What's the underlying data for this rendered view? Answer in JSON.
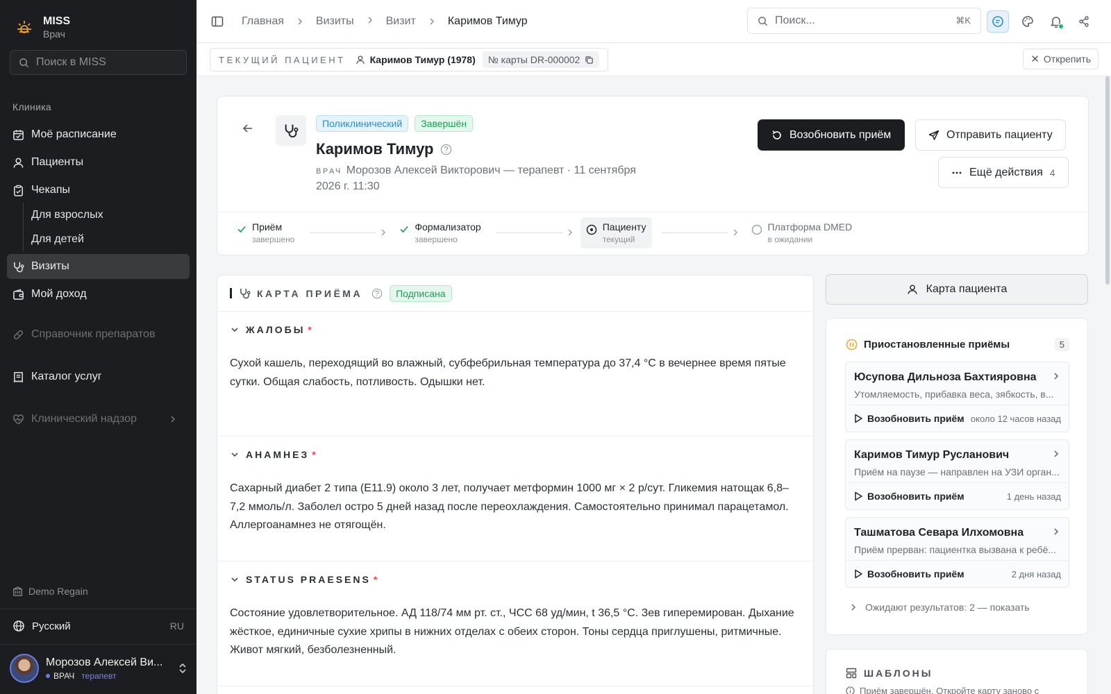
{
  "sidebar": {
    "app_name": "MISS",
    "app_role": "Врач",
    "search_placeholder": "Поиск в MISS",
    "section_label": "Клиника",
    "items": {
      "schedule": "Моё расписание",
      "patients": "Пациенты",
      "checkups": "Чекапы",
      "checkups_adults": "Для взрослых",
      "checkups_children": "Для детей",
      "visits": "Визиты",
      "income": "Мой доход",
      "drugs": "Справочник препаратов",
      "services": "Каталог услуг",
      "supervision": "Клинический надзор"
    },
    "region": "Demo Regain",
    "language": "Русский",
    "language_code": "RU",
    "user_name": "Морозов Алексей Ви...",
    "user_role": "ВРАЧ",
    "user_specialty": "терапевт"
  },
  "topbar": {
    "breadcrumbs": [
      "Главная",
      "Визиты",
      "Визит",
      "Каримов Тимур"
    ],
    "search_placeholder": "Поиск...",
    "search_shortcut": "⌘K"
  },
  "patient_strip": {
    "label": "ТЕКУЩИЙ ПАЦИЕНТ",
    "patient": "Каримов Тимур (1978)",
    "card_number": "№ карты DR-000002",
    "unpin": "Открепить"
  },
  "visit": {
    "type_badge": "Поликлинический",
    "status_badge": "Завершён",
    "patient_name": "Каримов Тимур",
    "doctor_prefix": "ВРАЧ",
    "doctor_line": "Морозов Алексей Викторович — терапевт · 11 сентября 2026 г. 11:30",
    "resume_button": "Возобновить приём",
    "send_button": "Отправить пациенту",
    "more_button": "Ещё действия",
    "more_count": "4",
    "steps": [
      {
        "title": "Приём",
        "status": "завершено"
      },
      {
        "title": "Формализатор",
        "status": "завершено"
      },
      {
        "title": "Пациенту",
        "status": "текущий"
      },
      {
        "title": "Платформа DMED",
        "status": "в ожидании"
      }
    ]
  },
  "exam": {
    "title": "КАРТА ПРИЁМА",
    "signed_badge": "Подписана",
    "sections": [
      {
        "title": "ЖАЛОБЫ",
        "required": "*",
        "text": "Сухой кашель, переходящий во влажный, субфебрильная температура до 37,4 °C в вечернее время пятые сутки. Общая слабость, потливость. Одышки нет."
      },
      {
        "title": "АНАМНЕЗ",
        "required": "*",
        "text": "Сахарный диабет 2 типа (E11.9) около 3 лет, получает метформин 1000 мг × 2 р/сут. Гликемия натощак 6,8–7,2 ммоль/л. Заболел остро 5 дней назад после переохлаждения. Самостоятельно принимал парацетамол. Аллергоанамнез не отягощён."
      },
      {
        "title": "STATUS PRAESENS",
        "required": "*",
        "text": "Состояние удовлетворительное. АД 118/74 мм рт. ст., ЧСС 68 уд/мин, t 36,5 °C. Зев гиперемирован. Дыхание жёсткое, единичные сухие хрипы в нижних отделах с обеих сторон. Тоны сердца приглушены, ритмичные. Живот мягкий, безболезненный."
      }
    ]
  },
  "right": {
    "patient_card_button": "Карта пациента",
    "paused_title": "Приостановленные приёмы",
    "paused_count": "5",
    "paused": [
      {
        "name": "Юсупова Дильноза Бахтияровна",
        "desc": "Утомляемость, прибавка веса, зябкость, в...",
        "resume": "Возобновить приём",
        "time": "около 12 часов назад"
      },
      {
        "name": "Каримов Тимур Русланович",
        "desc": "Приём на паузе — направлен на УЗИ орган...",
        "resume": "Возобновить приём",
        "time": "1 день назад"
      },
      {
        "name": "Ташматова Севара Илхомовна",
        "desc": "Приём прерван: пациентка вызвана к ребё...",
        "resume": "Возобновить приём",
        "time": "2 дня назад"
      }
    ],
    "awaiting": "Ожидают результатов: 2 — показать",
    "templates_title": "ШАБЛОНЫ",
    "templates_note": "Приём завершён. Откройте карту заново с"
  },
  "colors": {
    "sidebar_bg": "#1c1d20",
    "accent_green": "#1e9c5a",
    "accent_blue": "#2b8ccf",
    "paused_orange": "#f0a020",
    "required_red": "#e5484d"
  }
}
